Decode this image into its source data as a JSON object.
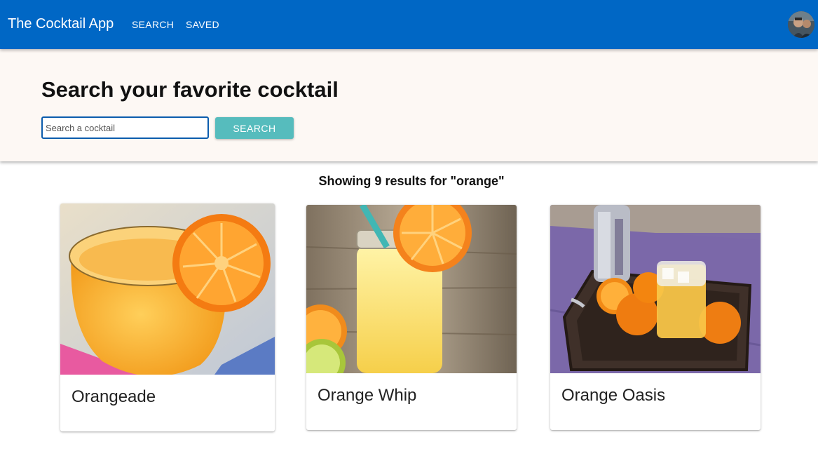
{
  "app": {
    "title": "The Cocktail App"
  },
  "nav": {
    "items": [
      {
        "label": "SEARCH"
      },
      {
        "label": "SAVED"
      }
    ]
  },
  "hero": {
    "title": "Search your favorite cocktail",
    "search_placeholder": "Search a cocktail",
    "search_value": "",
    "search_button_label": "SEARCH"
  },
  "results": {
    "summary": "Showing 9 results for \"orange\"",
    "cards": [
      {
        "name": "Orangeade",
        "image_icon": "orangeade-photo"
      },
      {
        "name": "Orange Whip",
        "image_icon": "orange-whip-photo"
      },
      {
        "name": "Orange Oasis",
        "image_icon": "orange-oasis-photo"
      }
    ]
  },
  "colors": {
    "appbar": "#0067c5",
    "hero_background": "#fdf8f4",
    "search_button": "#56bcbd",
    "input_border": "#0b5cad"
  }
}
